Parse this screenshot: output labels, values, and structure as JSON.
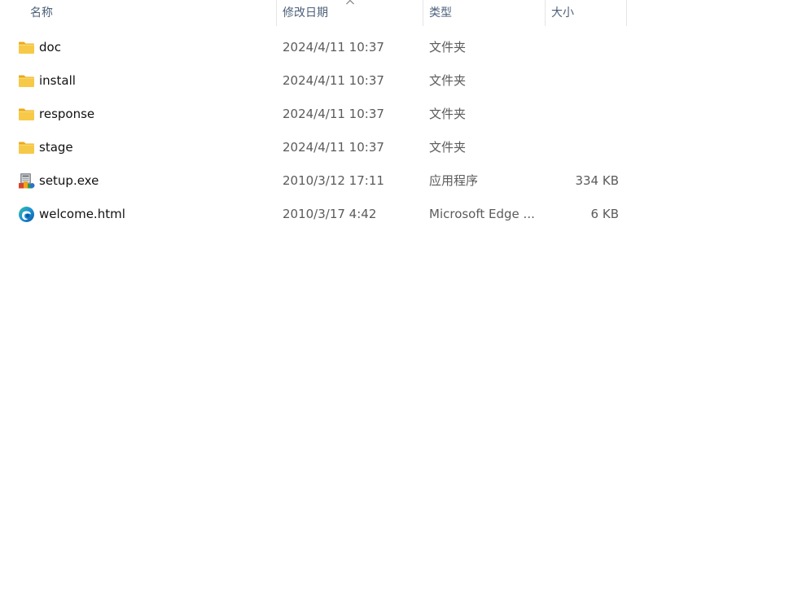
{
  "columns": {
    "name": "名称",
    "date": "修改日期",
    "type": "类型",
    "size": "大小"
  },
  "sort": {
    "column": "date",
    "icon": "chevron-up-icon"
  },
  "files": [
    {
      "name": "doc",
      "date": "2024/4/11 10:37",
      "type": "文件夹",
      "size": "",
      "icon": "folder-icon"
    },
    {
      "name": "install",
      "date": "2024/4/11 10:37",
      "type": "文件夹",
      "size": "",
      "icon": "folder-icon"
    },
    {
      "name": "response",
      "date": "2024/4/11 10:37",
      "type": "文件夹",
      "size": "",
      "icon": "folder-icon"
    },
    {
      "name": "stage",
      "date": "2024/4/11 10:37",
      "type": "文件夹",
      "size": "",
      "icon": "folder-icon"
    },
    {
      "name": "setup.exe",
      "date": "2010/3/12 17:11",
      "type": "应用程序",
      "size": "334 KB",
      "icon": "setup-exe-icon"
    },
    {
      "name": "welcome.html",
      "date": "2010/3/17 4:42",
      "type": "Microsoft Edge ...",
      "size": "6 KB",
      "icon": "edge-icon"
    }
  ],
  "colors": {
    "folder": "#f7c948",
    "folder_tab": "#e8aa1f",
    "header_text": "#4c607a",
    "edge_blue": "#0c59a4",
    "edge_green": "#35c1a0"
  }
}
